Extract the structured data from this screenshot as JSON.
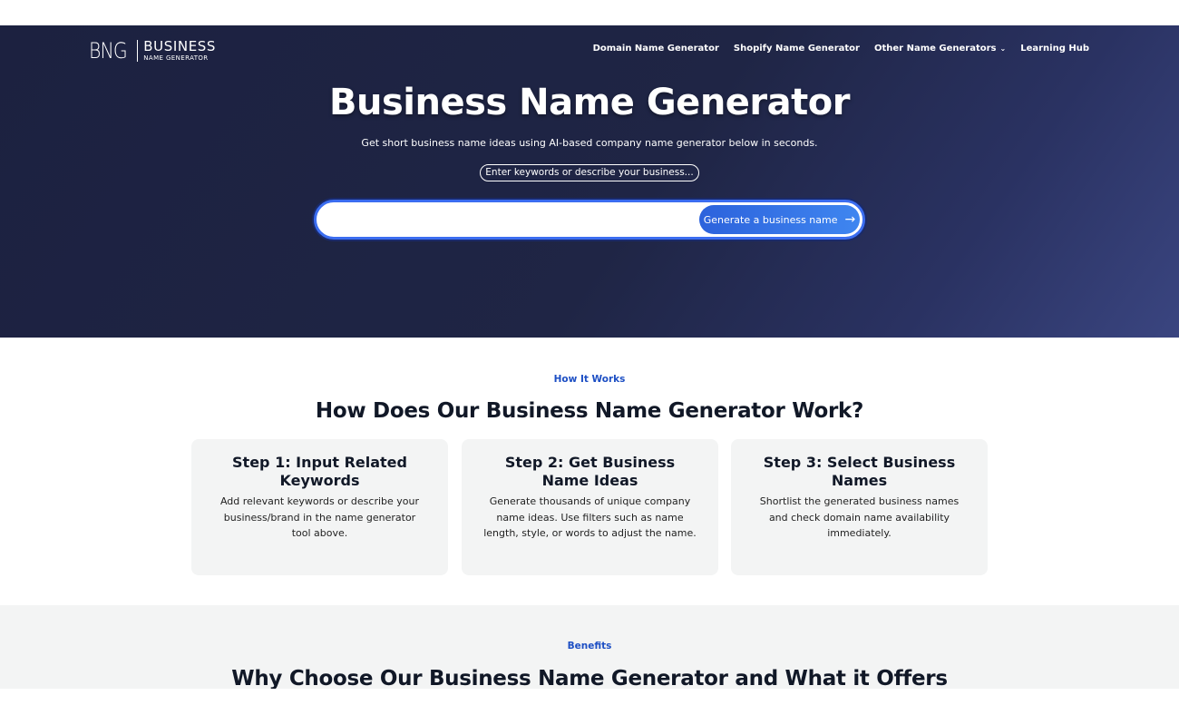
{
  "header": {
    "logo_mark": "BNG",
    "logo_line1": "BUSINESS",
    "logo_line2": "NAME GENERATOR",
    "nav": [
      {
        "label": "Domain Name Generator"
      },
      {
        "label": "Shopify Name Generator"
      },
      {
        "label": "Other Name Generators"
      },
      {
        "label": "Learning Hub"
      }
    ]
  },
  "hero": {
    "title": "Business Name Generator",
    "subtitle": "Get short business name ideas using AI-based company name generator below in seconds.",
    "hint": "Enter keywords or describe your business...",
    "search_value": "",
    "button_label": "Generate a business name"
  },
  "how": {
    "eyebrow": "How It Works",
    "title": "How Does Our Business Name Generator Work?",
    "steps": [
      {
        "title": "Step 1: Input Related Keywords",
        "text": "Add relevant keywords or describe your business/brand in the name generator tool above."
      },
      {
        "title": "Step 2: Get Business Name Ideas",
        "text": "Generate thousands of unique company name ideas. Use filters such as name length, style, or words to adjust the name."
      },
      {
        "title": "Step 3: Select Business Names",
        "text": "Shortlist the generated business names and check domain name availability immediately."
      }
    ]
  },
  "benefits": {
    "eyebrow": "Benefits",
    "title": "Why Choose Our Business Name Generator and What it Offers"
  },
  "colors": {
    "hero_bg": "#1f2545",
    "accent": "#3b6df0",
    "eyebrow": "#1d4fc4",
    "card_bg": "#f3f4f4"
  }
}
